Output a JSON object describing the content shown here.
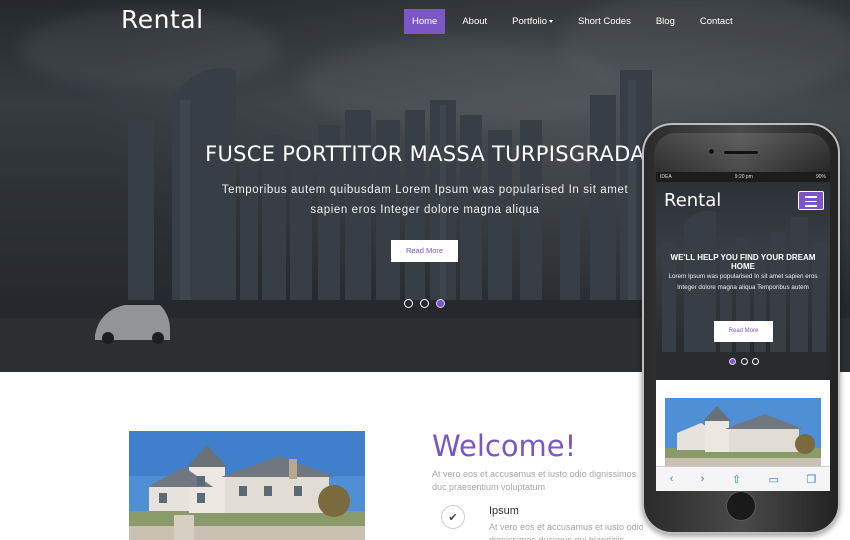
{
  "site": {
    "logo": "Rental"
  },
  "nav": {
    "items": [
      {
        "label": "Home",
        "active": true
      },
      {
        "label": "About"
      },
      {
        "label": "Portfolio"
      },
      {
        "label": "Short Codes"
      },
      {
        "label": "Blog"
      },
      {
        "label": "Contact"
      }
    ]
  },
  "hero": {
    "title": "FUSCE PORTTITOR MASSA TURPISGRADA",
    "text": "Temporibus autem quibusdam Lorem Ipsum was popularised In sit amet sapien eros Integer dolore magna aliqua",
    "button": "Read More",
    "slides": 3,
    "active_slide": 3
  },
  "welcome": {
    "title": "Welcome!",
    "text": "At vero eos et accusamus et iusto odio dignissimos duc praesentium voluptatum",
    "feature": {
      "icon": "check-icon",
      "title": "Ipsum",
      "text": "At vero eos et accusamus et iusto odio dignissimos ducimus qui blanditiis praesentium"
    }
  },
  "mobile": {
    "status": {
      "carrier": "IDEA",
      "time": "9:20 pm",
      "battery": "90%"
    },
    "logo": "Rental",
    "title": "WE'LL HELP YOU FIND YOUR DREAM HOME",
    "text": "Lorem Ipsum was popularised In sit amet sapien eros Integer dolore magna aliqua Temporibus autem",
    "button": "Read More",
    "active_slide": 1
  },
  "colors": {
    "accent": "#7a57c5",
    "text_muted": "#a8a8a8"
  }
}
